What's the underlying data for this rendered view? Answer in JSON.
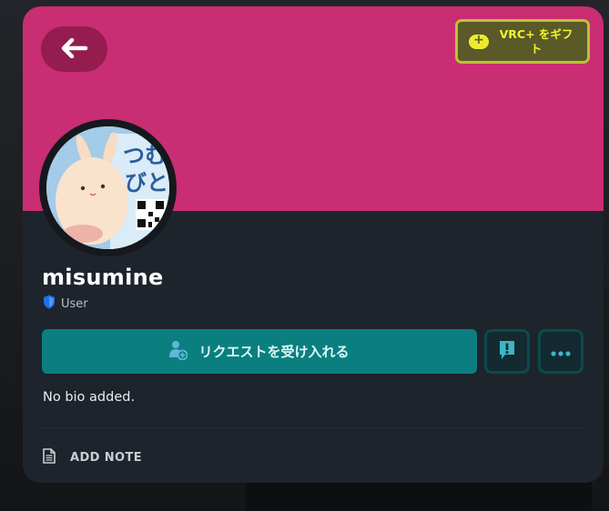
{
  "header": {
    "back_icon": "arrow-left-icon",
    "gift_label": "VRC+ をギフト",
    "gift_icon": "chat-bubble-plus-icon"
  },
  "profile": {
    "username": "misumine",
    "role": "User",
    "role_icon": "shield-icon",
    "avatar_text": "つむ\nびと"
  },
  "actions": {
    "friend_request_label": "リクエストを受け入れる",
    "friend_request_icon": "person-add-icon",
    "report_icon": "report-exclamation-icon",
    "more_icon": "more-dots-icon"
  },
  "bio": {
    "text": "No bio added."
  },
  "note": {
    "label": "ADD NOTE",
    "icon": "note-document-icon"
  },
  "colors": {
    "banner": "#c92d73",
    "accent_teal": "#0b7f80",
    "gift_yellow": "#f3f330",
    "card_bg": "#1e242b"
  }
}
